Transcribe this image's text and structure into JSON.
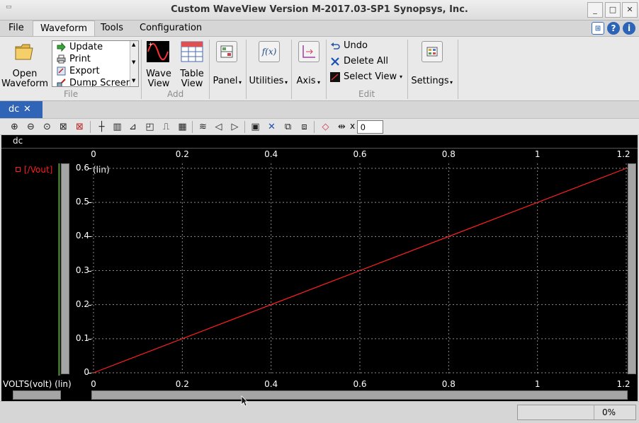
{
  "window": {
    "title": "Custom WaveView Version M-2017.03-SP1 Synopsys, Inc.",
    "buttons": [
      "_",
      "□",
      "✕"
    ]
  },
  "menubar": {
    "items": [
      "File",
      "Waveform",
      "Tools",
      "Configuration"
    ],
    "active": "Waveform"
  },
  "ribbon": {
    "open_waveform": "Open\nWaveform",
    "file_list": [
      "Update",
      "Print",
      "Export",
      "Dump Screen"
    ],
    "group_file": "File",
    "wave_view": "Wave\nView",
    "table_view": "Table\nView",
    "group_add": "Add",
    "panel": "Panel",
    "utilities": "Utilities",
    "axis": "Axis",
    "edit_undo": "Undo",
    "edit_delete_all": "Delete All",
    "edit_select_view": "Select View",
    "group_edit": "Edit",
    "settings": "Settings"
  },
  "document_tab": {
    "label": "dc",
    "close": "✕"
  },
  "toolbar": {
    "multiplier_symbol": "x",
    "input_value": "0"
  },
  "panel": {
    "name": "dc",
    "signal": "[/Vout]",
    "trace_color": "#ff2020",
    "grid_color": "#8a8a8a",
    "y_scale_label": "(lin)",
    "x_axis_label": "VOLTS(volt) (lin)"
  },
  "chart_data": {
    "type": "line",
    "x_ticks": [
      "0",
      "0.2",
      "0.4",
      "0.6",
      "0.8",
      "1",
      "1.2"
    ],
    "y_ticks": [
      "0.6",
      "0.5",
      "0.4",
      "0.3",
      "0.2",
      "0.1",
      "0"
    ],
    "xlim": [
      0,
      1.2
    ],
    "ylim": [
      0,
      0.6
    ],
    "grid": true,
    "series": [
      {
        "name": "[/Vout]",
        "x": [
          0,
          1.2
        ],
        "y": [
          0,
          0.6
        ]
      }
    ]
  },
  "statusbar": {
    "progress_text": "0%"
  }
}
